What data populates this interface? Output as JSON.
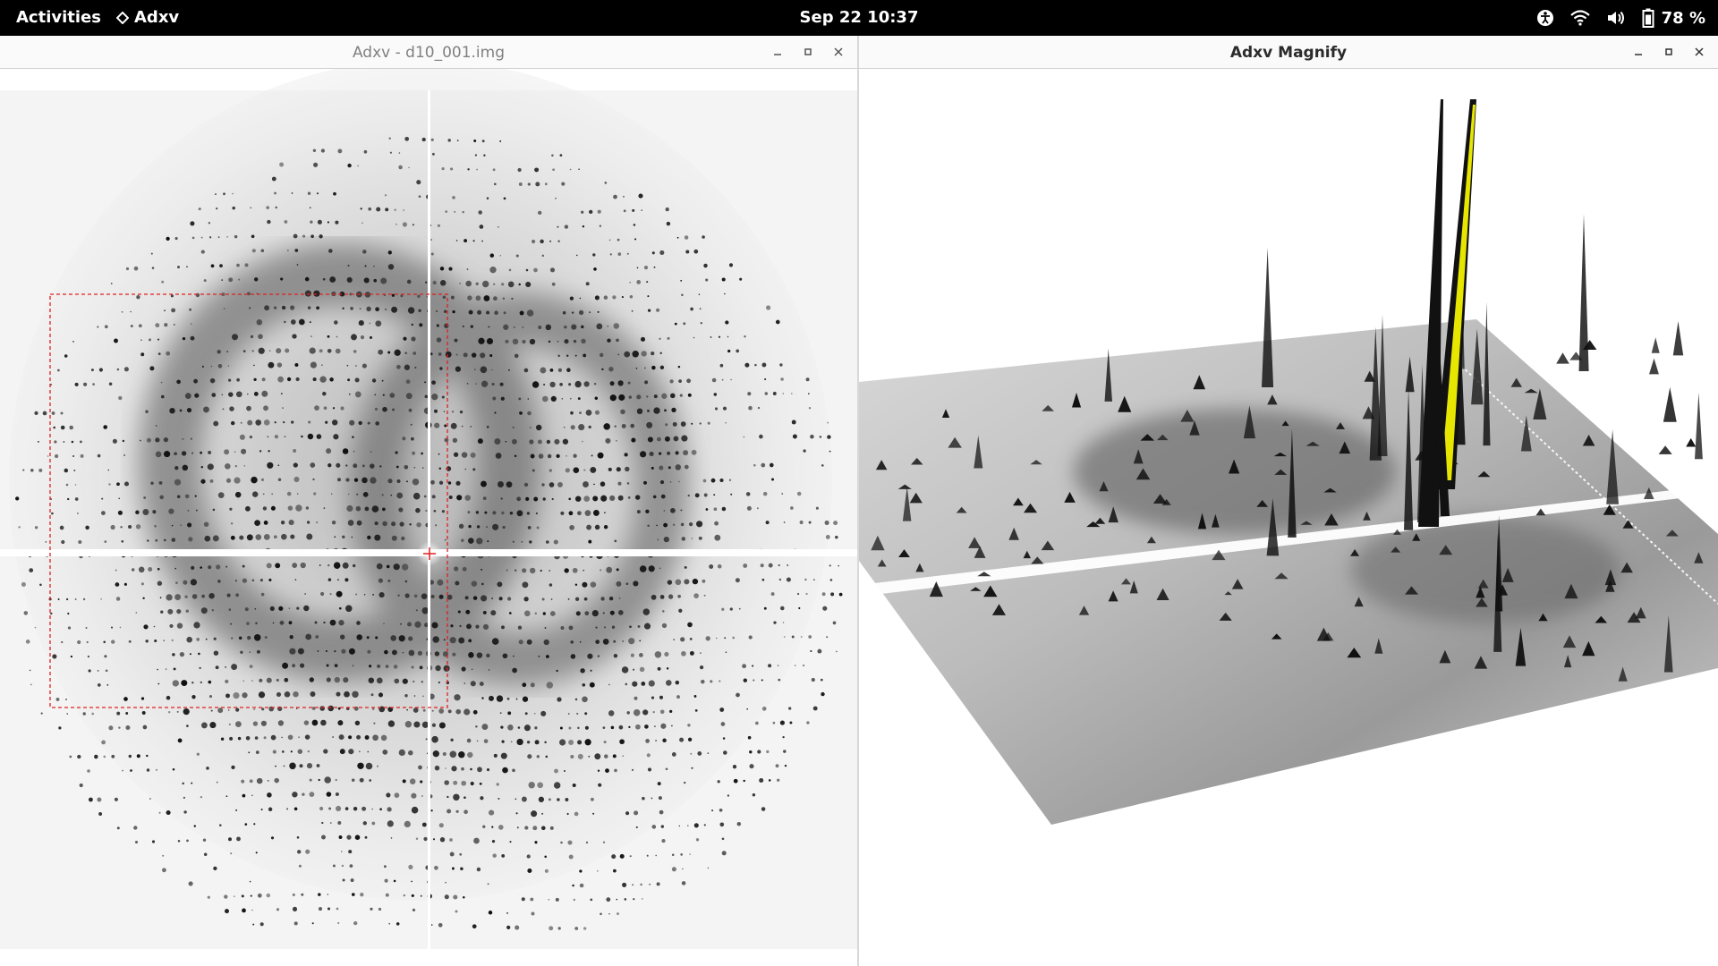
{
  "topbar": {
    "activities": "Activities",
    "app_name": "Adxv",
    "clock": "Sep 22  10:37",
    "battery_percent": "78 %",
    "icons": [
      "accessibility-icon",
      "wifi-icon",
      "volume-icon",
      "battery-icon"
    ]
  },
  "left_window": {
    "title": "Adxv - d10_001.img",
    "controls": [
      "minimize",
      "maximize",
      "close"
    ],
    "image_content": "x-ray diffraction pattern with beam center crosshair and dashed red selection box"
  },
  "right_window": {
    "title": "Adxv Magnify",
    "controls": [
      "minimize",
      "maximize",
      "close"
    ],
    "image_content": "3D surface view of magnified diffraction region"
  },
  "colors": {
    "topbar_bg": "#000000",
    "selection_box": "#e02020",
    "spot": "#111111",
    "peak_highlight": "#e6e600"
  }
}
